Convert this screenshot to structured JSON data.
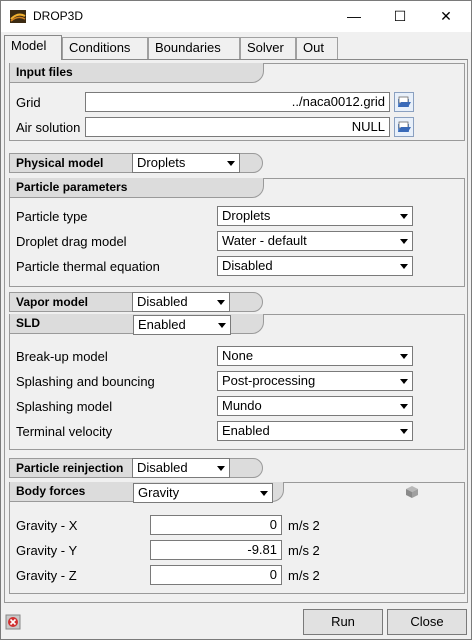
{
  "window": {
    "title": "DROP3D",
    "minimize_glyph": "—",
    "maximize_glyph": "☐",
    "close_glyph": "✕"
  },
  "tabs": [
    "Model",
    "Conditions",
    "Boundaries",
    "Solver",
    "Out"
  ],
  "input_files": {
    "header": "Input files",
    "grid_label": "Grid",
    "grid_value": "../naca0012.grid",
    "air_label": "Air solution",
    "air_value": "NULL"
  },
  "physical_model": {
    "label": "Physical model",
    "value": "Droplets"
  },
  "particle_parameters": {
    "header": "Particle parameters",
    "rows": [
      {
        "label": "Particle type",
        "value": "Droplets"
      },
      {
        "label": "Droplet drag model",
        "value": "Water - default"
      },
      {
        "label": "Particle thermal equation",
        "value": "Disabled"
      }
    ]
  },
  "vapor_model": {
    "label": "Vapor model",
    "value": "Disabled"
  },
  "sld": {
    "label": "SLD",
    "value": "Enabled",
    "rows": [
      {
        "label": "Break-up model",
        "value": "None"
      },
      {
        "label": "Splashing and bouncing",
        "value": "Post-processing"
      },
      {
        "label": "Splashing model",
        "value": "Mundo"
      },
      {
        "label": "Terminal velocity",
        "value": "Enabled"
      }
    ]
  },
  "particle_reinjection": {
    "label": "Particle reinjection",
    "value": "Disabled"
  },
  "body_forces": {
    "label": "Body forces",
    "value": "Gravity",
    "rows": [
      {
        "label": "Gravity - X",
        "value": "0",
        "unit": "m/s 2"
      },
      {
        "label": "Gravity - Y",
        "value": "-9.81",
        "unit": "m/s 2"
      },
      {
        "label": "Gravity - Z",
        "value": "0",
        "unit": "m/s 2"
      }
    ]
  },
  "buttons": {
    "run": "Run",
    "close": "Close"
  },
  "icons": {
    "app": "drop3d-app-icon",
    "browse": "folder-open-icon",
    "cube": "cube-icon",
    "status": "stop-icon"
  },
  "colors": {
    "section_header": "#dcdcdc",
    "background": "#f0f0f0"
  }
}
